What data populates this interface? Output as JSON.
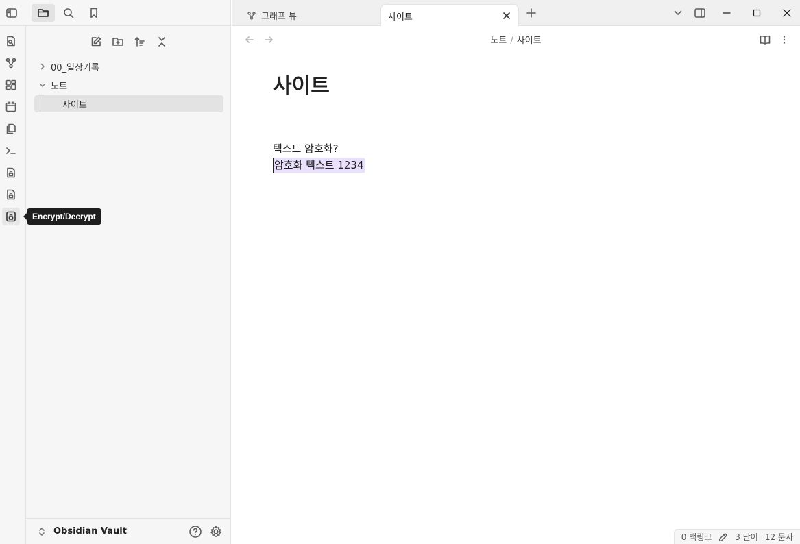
{
  "sidebar": {
    "tree": [
      {
        "label": "00_일상기록",
        "expanded": false
      },
      {
        "label": "노트",
        "expanded": true
      }
    ],
    "active_file": "사이트",
    "vault_name": "Obsidian Vault"
  },
  "tooltip": "Encrypt/Decrypt",
  "tabs": [
    {
      "label": "그래프 뷰",
      "active": false
    },
    {
      "label": "사이트",
      "active": true
    }
  ],
  "breadcrumb": {
    "folder": "노트",
    "separator": "/",
    "file": "사이트"
  },
  "note": {
    "title": "사이트",
    "lines": [
      "텍스트 암호화?",
      "암호화 텍스트 1234"
    ]
  },
  "status": {
    "backlinks": "0 백링크",
    "words": "3 단어",
    "chars": "12 문자"
  },
  "colors": {
    "accent_highlight": "#e9e0fb",
    "sidebar_bg": "#f6f6f6",
    "tooltip_bg": "#1e1e1e"
  }
}
